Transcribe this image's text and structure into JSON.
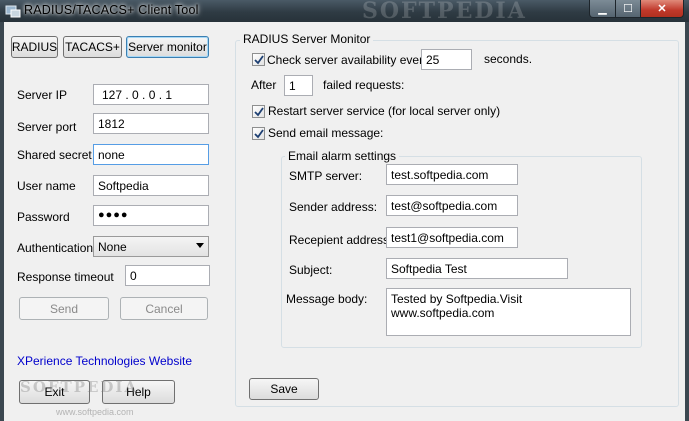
{
  "window": {
    "title": "RADIUS/TACACS+ Client Tool",
    "watermark": "SOFTPEDIA"
  },
  "tabs": [
    {
      "label": "RADIUS"
    },
    {
      "label": "TACACS+"
    },
    {
      "label": "Server monitor",
      "selected": true
    }
  ],
  "left": {
    "server_ip": {
      "label": "Server IP",
      "value": "127 .  0  .  0  .  1"
    },
    "server_port": {
      "label": "Server port",
      "value": "1812"
    },
    "shared_secret": {
      "label": "Shared secret",
      "value": "none"
    },
    "user_name": {
      "label": "User name",
      "value": "Softpedia"
    },
    "password": {
      "label": "Password",
      "value": "●●●●"
    },
    "authentication": {
      "label": "Authentication",
      "value": "None"
    },
    "response_timeout": {
      "label": "Response timeout",
      "value": "0"
    },
    "send_label": "Send",
    "cancel_label": "Cancel",
    "website_link": "XPerience Technologies Website",
    "exit_label": "Exit",
    "help_label": "Help"
  },
  "monitor": {
    "group_title": "RADIUS Server Monitor",
    "check_label": "Check server availability every",
    "check_checked": true,
    "interval_value": "25",
    "seconds_label": "seconds.",
    "after_label": "After",
    "failed_value": "1",
    "failed_label": "failed requests:",
    "restart_label": "Restart server service (for local server only)",
    "restart_checked": true,
    "email_label": "Send email message:",
    "email_checked": true,
    "email_group_title": "Email alarm settings",
    "smtp": {
      "label": "SMTP server:",
      "value": "test.softpedia.com"
    },
    "sender": {
      "label": "Sender address:",
      "value": "test@softpedia.com"
    },
    "recipient": {
      "label": "Recepient address:",
      "value": "test1@softpedia.com"
    },
    "subject": {
      "label": "Subject:",
      "value": "Softpedia Test"
    },
    "body": {
      "label": "Message body:",
      "value": "Tested by Softpedia.Visit www.softpedia.com"
    },
    "save_label": "Save"
  },
  "footer": {
    "watermark": "SOFTPEDIA",
    "watermark_url": "www.softpedia.com"
  },
  "colors": {
    "accent": "#3c7fb1",
    "link": "#0000cc",
    "titlebar": "#2f3b44"
  }
}
